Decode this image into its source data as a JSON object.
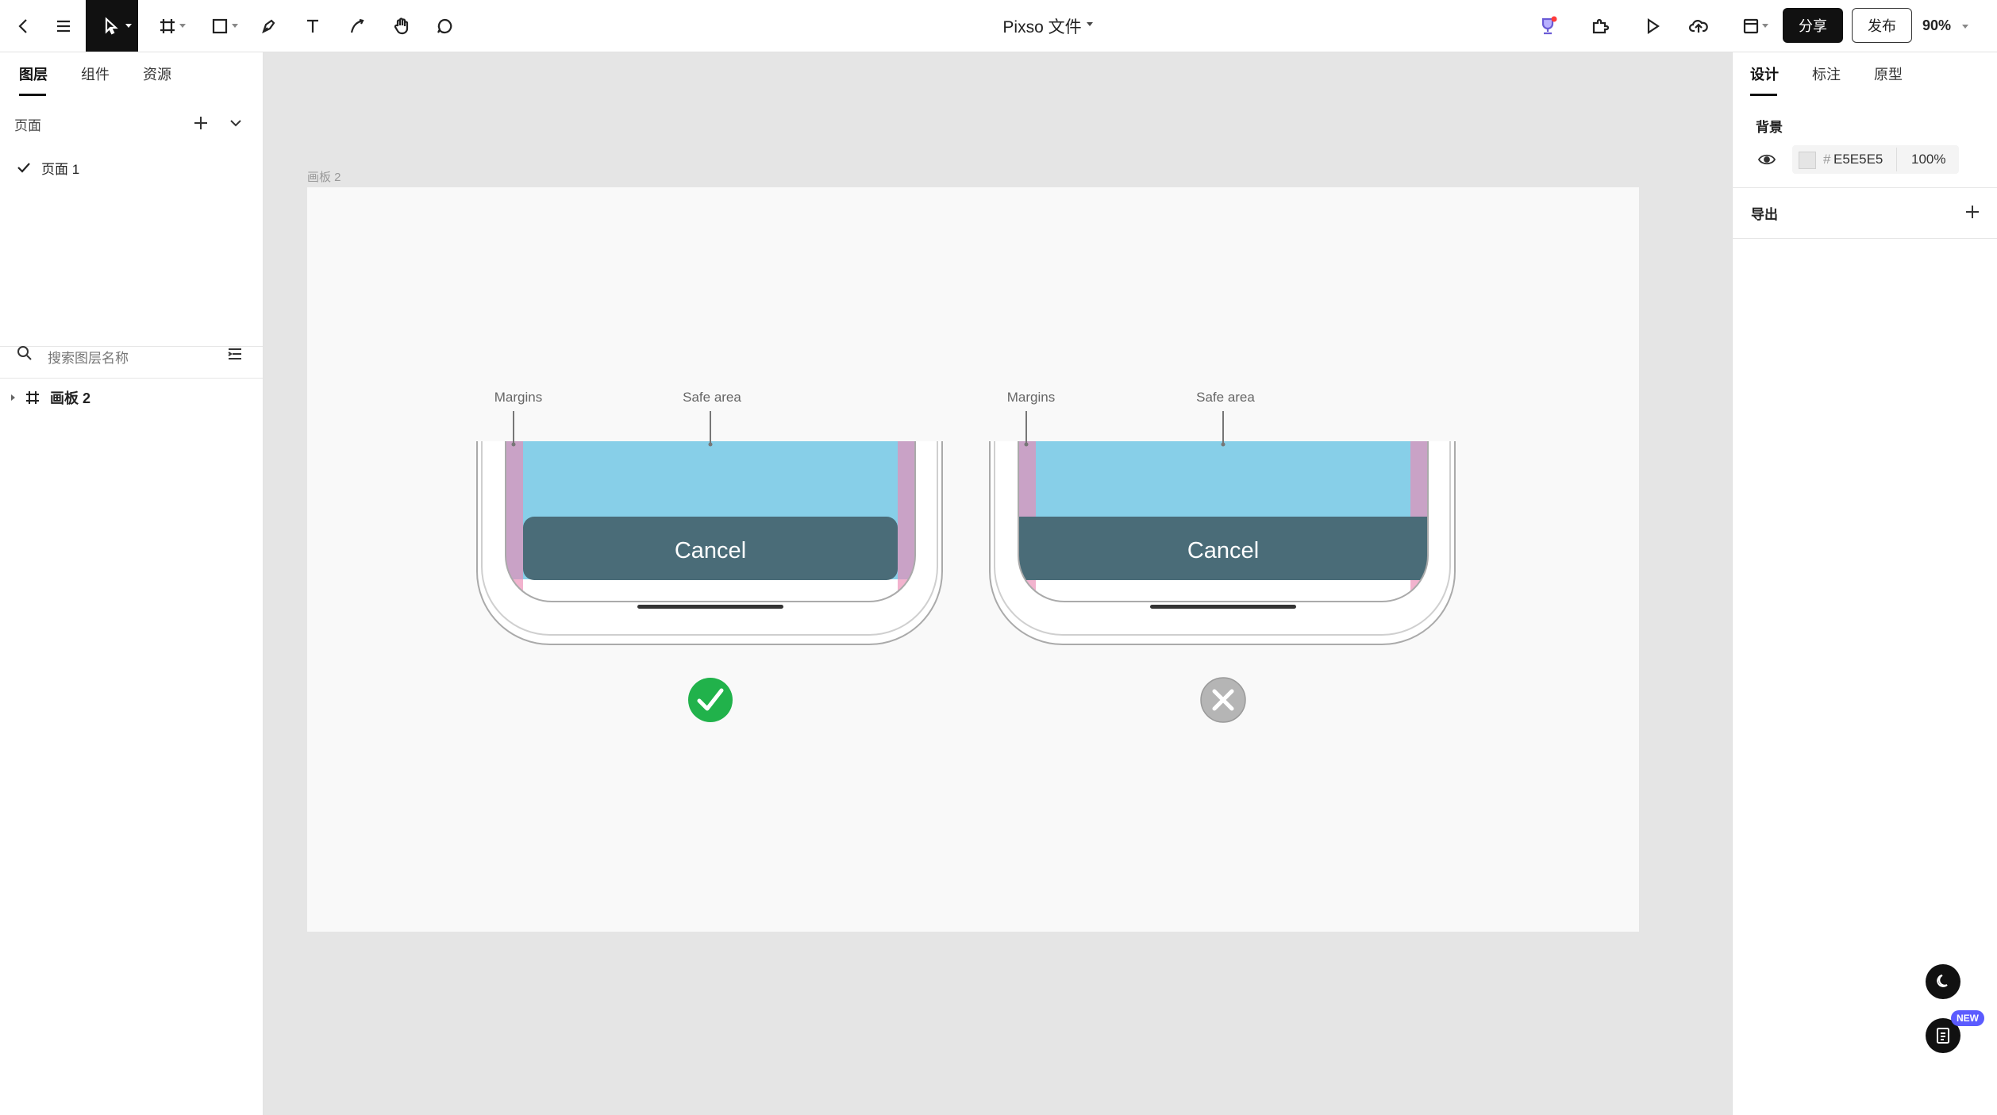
{
  "toolbar": {
    "file_title": "Pixso 文件",
    "share_label": "分享",
    "publish_label": "发布",
    "zoom": "90%"
  },
  "left_panel": {
    "tabs": [
      "图层",
      "组件",
      "资源"
    ],
    "active_tab": "图层",
    "pages_label": "页面",
    "pages": [
      {
        "label": "页面 1",
        "selected": true
      }
    ],
    "search_placeholder": "搜索图层名称",
    "layers": [
      {
        "label": "画板 2",
        "type": "frame"
      }
    ]
  },
  "right_panel": {
    "tabs": [
      "设计",
      "标注",
      "原型"
    ],
    "active_tab": "设计",
    "background_label": "背景",
    "background_hash": "#",
    "background_color": "E5E5E5",
    "background_opacity": "100%",
    "export_label": "导出"
  },
  "canvas": {
    "frame_label": "画板 2",
    "background": "#E5E5E5",
    "frame_fill": "#F9F9F9",
    "mockups": [
      {
        "margin_label": "Margins",
        "safe_area_label": "Safe area",
        "button_label": "Cancel",
        "verdict": "correct"
      },
      {
        "margin_label": "Margins",
        "safe_area_label": "Safe area",
        "button_label": "Cancel",
        "verdict": "incorrect"
      }
    ],
    "colors": {
      "safe_area": "#87CFE8",
      "margin": "#C9A2C6",
      "margin_lower": "#F2B3CE",
      "button": "#4A6C78",
      "correct": "#21B24B",
      "incorrect": "#B5B5B5"
    }
  },
  "floating": {
    "new_badge": "NEW"
  }
}
